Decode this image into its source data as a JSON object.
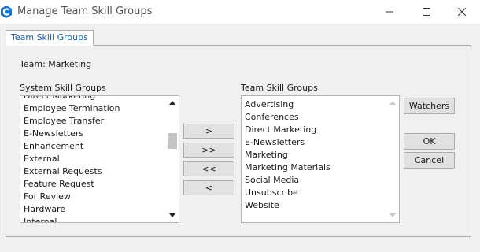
{
  "window": {
    "title": "Manage Team Skill Groups"
  },
  "tab": {
    "label": "Team Skill Groups"
  },
  "team": {
    "label": "Team: Marketing"
  },
  "system_list": {
    "caption": "System Skill Groups",
    "items": [
      "Direct Marketing",
      "Employee Termination",
      "Employee Transfer",
      "E-Newsletters",
      "Enhancement",
      "External",
      "External Requests",
      "Feature Request",
      "For Review",
      "Hardware",
      "Internal"
    ]
  },
  "team_list": {
    "caption": "Team Skill Groups",
    "items": [
      "Advertising",
      "Conferences",
      "Direct Marketing",
      "E-Newsletters",
      "Marketing",
      "Marketing Materials",
      "Social Media",
      "Unsubscribe",
      "Website"
    ]
  },
  "move_buttons": {
    "add": ">",
    "add_all": ">>",
    "remove_all": "<<",
    "remove": "<"
  },
  "actions": {
    "watchers": "Watchers",
    "ok": "OK",
    "cancel": "Cancel"
  },
  "colors": {
    "accent": "#1a5da8",
    "app_icon": "#1577c8"
  }
}
